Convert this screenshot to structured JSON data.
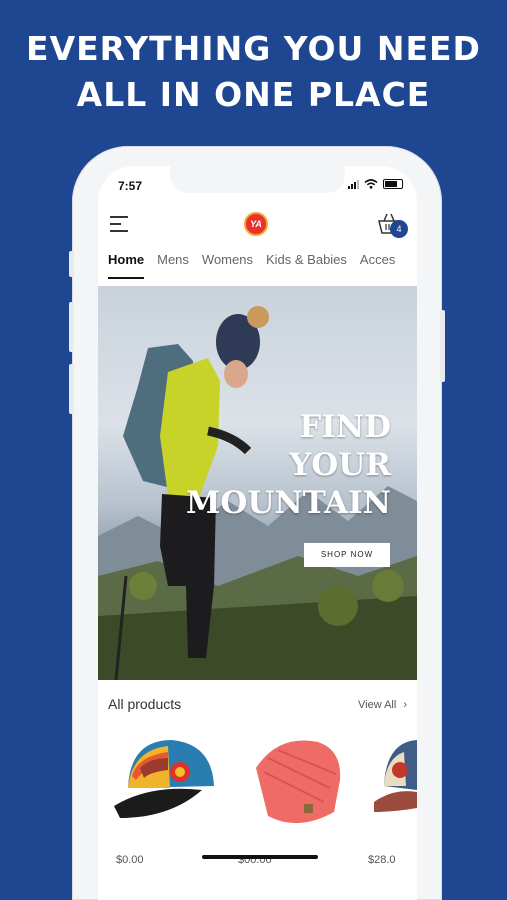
{
  "promo": {
    "headline_line1": "EVERYTHING YOU NEED",
    "headline_line2": "ALL IN ONE PLACE",
    "background": "#1f4690"
  },
  "status_bar": {
    "time": "7:57"
  },
  "header": {
    "logo_text": "YA",
    "cart_count": "4",
    "menu_icon": "hamburger-icon",
    "cart_icon": "basket-icon"
  },
  "tabs": [
    "Home",
    "Mens",
    "Womens",
    "Kids & Babies",
    "Acces"
  ],
  "hero": {
    "line1": "FIND",
    "line2": "YOUR",
    "line3": "MOUNTAIN",
    "cta": "SHOP NOW"
  },
  "products_section": {
    "title": "All products",
    "view_all": "View All"
  },
  "products": [
    {
      "name_icon": "cap-icon",
      "price": "$0.00"
    },
    {
      "name_icon": "beanie-icon",
      "price": "$00.00"
    },
    {
      "name_icon": "trucker-cap-icon",
      "price": "$28.0"
    }
  ],
  "accent": "#1f4690"
}
